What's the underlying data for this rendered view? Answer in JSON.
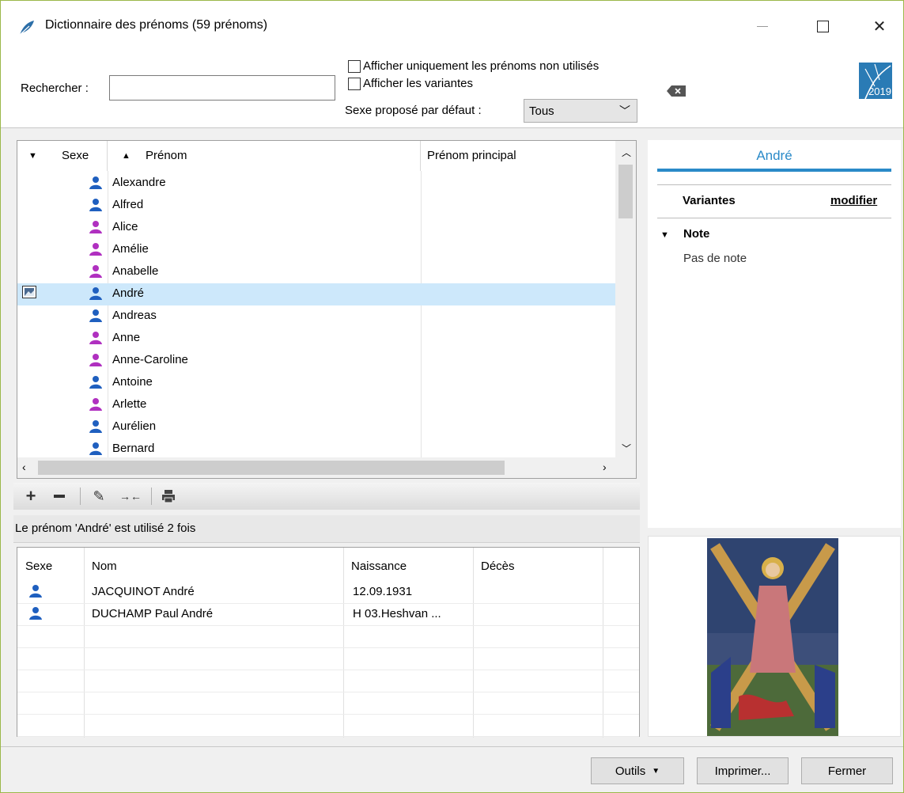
{
  "window": {
    "title": "Dictionnaire des prénoms (59 prénoms)",
    "controls": [
      "minimize",
      "maximize",
      "close"
    ]
  },
  "filters": {
    "search_label": "Rechercher :",
    "search_value": "",
    "only_unused_label": "Afficher uniquement les prénoms non utilisés",
    "only_unused_checked": false,
    "show_variants_label": "Afficher les variantes",
    "show_variants_checked": false,
    "default_sex_label": "Sexe proposé par défaut :",
    "default_sex_value": "Tous"
  },
  "logo": {
    "text": "2019"
  },
  "names_table": {
    "columns": {
      "sex": "Sexe",
      "name": "Prénom",
      "main": "Prénom principal"
    },
    "rows": [
      {
        "name": "Alexandre",
        "sex": "male",
        "main": ""
      },
      {
        "name": "Alfred",
        "sex": "male",
        "main": ""
      },
      {
        "name": "Alice",
        "sex": "female",
        "main": ""
      },
      {
        "name": "Amélie",
        "sex": "female",
        "main": ""
      },
      {
        "name": "Anabelle",
        "sex": "female",
        "main": ""
      },
      {
        "name": "André",
        "sex": "male",
        "main": "",
        "selected": true,
        "has_image": true
      },
      {
        "name": "Andreas",
        "sex": "male",
        "main": ""
      },
      {
        "name": "Anne",
        "sex": "female",
        "main": ""
      },
      {
        "name": "Anne-Caroline",
        "sex": "female",
        "main": ""
      },
      {
        "name": "Antoine",
        "sex": "male",
        "main": ""
      },
      {
        "name": "Arlette",
        "sex": "female",
        "main": ""
      },
      {
        "name": "Aurélien",
        "sex": "male",
        "main": ""
      },
      {
        "name": "Bernard",
        "sex": "male",
        "main": ""
      }
    ]
  },
  "usage_text": "Le prénom 'André' est utilisé 2 fois",
  "people_table": {
    "columns": {
      "sex": "Sexe",
      "name": "Nom",
      "birth": "Naissance",
      "death": "Décès"
    },
    "rows": [
      {
        "sex": "male",
        "name": "JACQUINOT André",
        "birth": "12.09.1931",
        "death": ""
      },
      {
        "sex": "male",
        "name": "DUCHAMP Paul André",
        "birth": "H 03.Heshvan ...",
        "death": ""
      }
    ]
  },
  "detail": {
    "name": "André",
    "variants_label": "Variantes",
    "modify_label": "modifier",
    "note_label": "Note",
    "note_text": "Pas de note"
  },
  "buttons": {
    "tools": "Outils",
    "print": "Imprimer...",
    "close": "Fermer"
  },
  "colors": {
    "male": "#1f5fbf",
    "female": "#b030c0",
    "selected_row": "#cde8fb",
    "accent": "#2a8ac8"
  }
}
